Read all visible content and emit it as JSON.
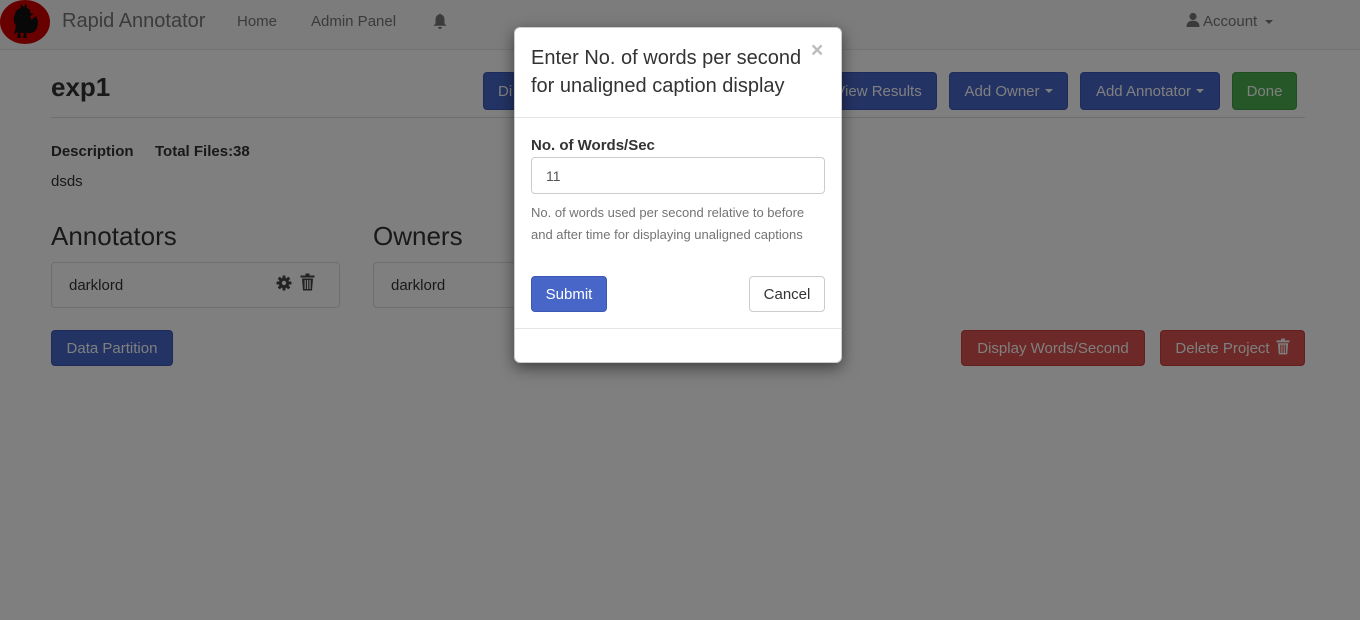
{
  "navbar": {
    "brand": "Rapid Annotator",
    "links": [
      "Home",
      "Admin Panel"
    ],
    "account": "Account"
  },
  "project": {
    "title": "exp1",
    "description_label": "Description",
    "total_files_label": "Total Files:38",
    "description": "dsds"
  },
  "toolbar": {
    "display_partial": "Di",
    "view_results": "View Results",
    "add_owner": "Add Owner",
    "add_annotator": "Add Annotator",
    "done": "Done"
  },
  "annotators": {
    "title": "Annotators",
    "items": [
      "darklord"
    ]
  },
  "owners": {
    "title": "Owners",
    "items": [
      "darklord"
    ]
  },
  "actions": {
    "data_partition": "Data Partition",
    "display_words_second": "Display Words/Second",
    "delete_project": "Delete Project"
  },
  "modal": {
    "title": "Enter No. of words per second for unaligned caption display",
    "close": "×",
    "field_label": "No. of Words/Sec",
    "field_value": "11",
    "help": "No. of words used per second relative to before and after time for displaying unaligned captions",
    "submit": "Submit",
    "cancel": "Cancel"
  },
  "colors": {
    "primary": "#4766c8",
    "success": "#4caf50",
    "danger": "#d9534f",
    "logo": "#d10000"
  }
}
